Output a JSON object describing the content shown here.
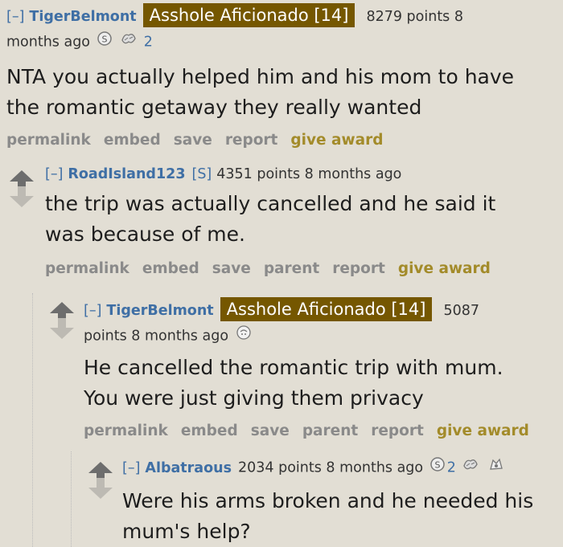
{
  "comments": [
    {
      "toggle": "[–]",
      "author": "TigerBelmont",
      "flair": "Asshole Aficionado [14]",
      "points": "8279 points 8",
      "time": "months ago",
      "award_count": "2",
      "body": [
        "NTA you actually helped him and his mom to have",
        "the romantic getaway they really wanted"
      ],
      "buttons": [
        "permalink",
        "embed",
        "save",
        "report"
      ],
      "award_label": "give award"
    },
    {
      "toggle": "[–]",
      "author": "RoadIsland123",
      "op_tag": "[S]",
      "points": "4351 points 8 months ago",
      "body": [
        "the trip was actually cancelled and he said it",
        "was because of me."
      ],
      "buttons": [
        "permalink",
        "embed",
        "save",
        "parent",
        "report"
      ],
      "award_label": "give award"
    },
    {
      "toggle": "[–]",
      "author": "TigerBelmont",
      "flair": "Asshole Aficionado [14]",
      "points": "5087",
      "time": "points 8 months ago",
      "body": [
        "He cancelled the romantic trip with mum.",
        "You were just giving them privacy"
      ],
      "buttons": [
        "permalink",
        "embed",
        "save",
        "parent",
        "report"
      ],
      "award_label": "give award"
    },
    {
      "toggle": "[–]",
      "author": "Albatraous",
      "points": "2034 points 8 months ago",
      "award_count": "2",
      "body": [
        "Were his arms broken and he needed his",
        "mum's help?"
      ]
    }
  ]
}
